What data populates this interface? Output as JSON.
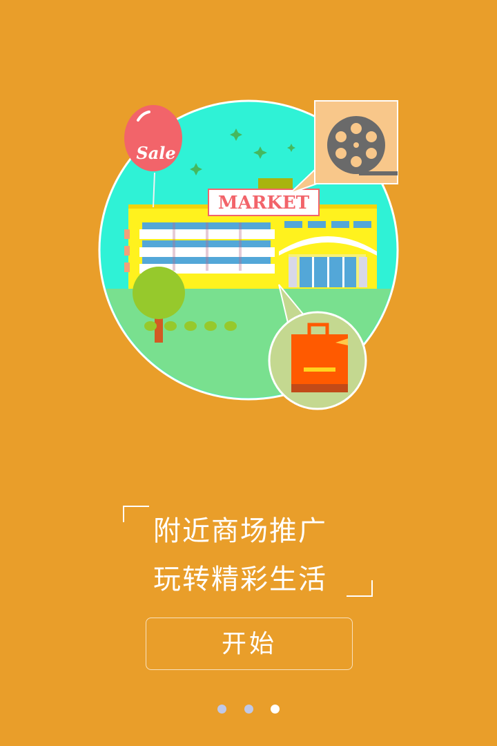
{
  "illustration": {
    "balloon_text": "Sale",
    "sign_text": "MARKET"
  },
  "slogan": {
    "line1": "附近商场推广",
    "line2": "玩转精彩生活"
  },
  "start_button": {
    "label": "开始"
  },
  "pagination": {
    "total": 3,
    "active_index": 2
  },
  "colors": {
    "background": "#E99E2A",
    "circle": "#2FF2D6",
    "building": "#FFF21E",
    "balloon": "#F2646A",
    "bag": "#FF5A00"
  }
}
